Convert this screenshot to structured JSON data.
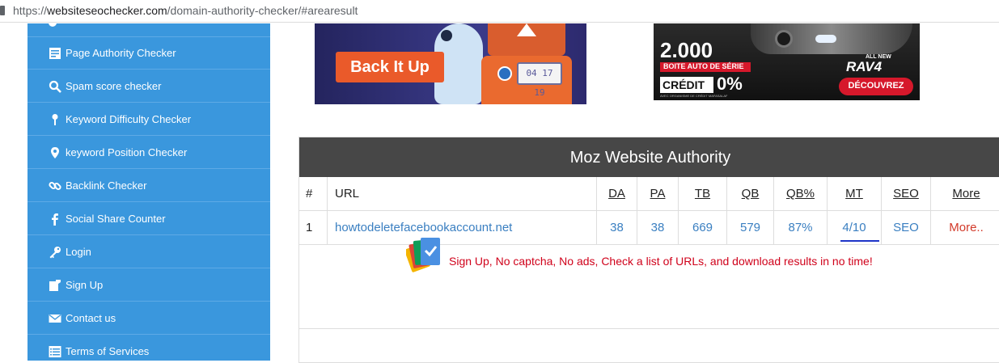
{
  "address_bar": {
    "scheme": "https://",
    "host": "websiteseochecker.com",
    "path": "/domain-authority-checker/#arearesult"
  },
  "sidebar": {
    "items": [
      {
        "label": "Page Authority Checker",
        "icon": "document-icon"
      },
      {
        "label": "Spam score checker",
        "icon": "search-icon"
      },
      {
        "label": "Keyword Difficulty Checker",
        "icon": "pin-icon"
      },
      {
        "label": "keyword Position Checker",
        "icon": "location-icon"
      },
      {
        "label": "Backlink Checker",
        "icon": "link-icon"
      },
      {
        "label": "Social Share Counter",
        "icon": "facebook-icon"
      },
      {
        "label": "Login",
        "icon": "key-icon"
      },
      {
        "label": "Sign Up",
        "icon": "signup-icon"
      },
      {
        "label": "Contact us",
        "icon": "envelope-icon"
      },
      {
        "label": "Terms of Services",
        "icon": "list-icon"
      }
    ]
  },
  "ad_left": {
    "button_text": "Back It Up",
    "counter": "04 17 19"
  },
  "ad_right": {
    "headline": "2.000",
    "line1": "BOITE AUTO DE SÉRIE",
    "line2": "CRÉDIT",
    "percent": "0%",
    "fineprint": "AVEC ORGANISME DE CRÉDIT MAFASALAF",
    "badge_top": "ALL NEW",
    "model": "RAV4",
    "cta": "DÉCOUVREZ"
  },
  "results": {
    "title": "Moz Website Authority",
    "columns": [
      "#",
      "URL",
      "DA",
      "PA",
      "TB",
      "QB",
      "QB%",
      "MT",
      "SEO",
      "More"
    ],
    "rows": [
      {
        "num": "1",
        "url": "howtodeletefacebookaccount.net",
        "da": "38",
        "pa": "38",
        "tb": "669",
        "qb": "579",
        "qbp": "87%",
        "mt": "4/10",
        "seo": "SEO",
        "more": "More.."
      }
    ],
    "mt_progress": 0.4,
    "signup_text": "Sign Up, No captcha, No ads, Check a list of URLs, and download results in no time!"
  },
  "colors": {
    "sidebar": "#3a97dd",
    "header": "#474747",
    "link": "#3a7fc1",
    "more": "#d23a2a",
    "signup": "#d0021b"
  }
}
